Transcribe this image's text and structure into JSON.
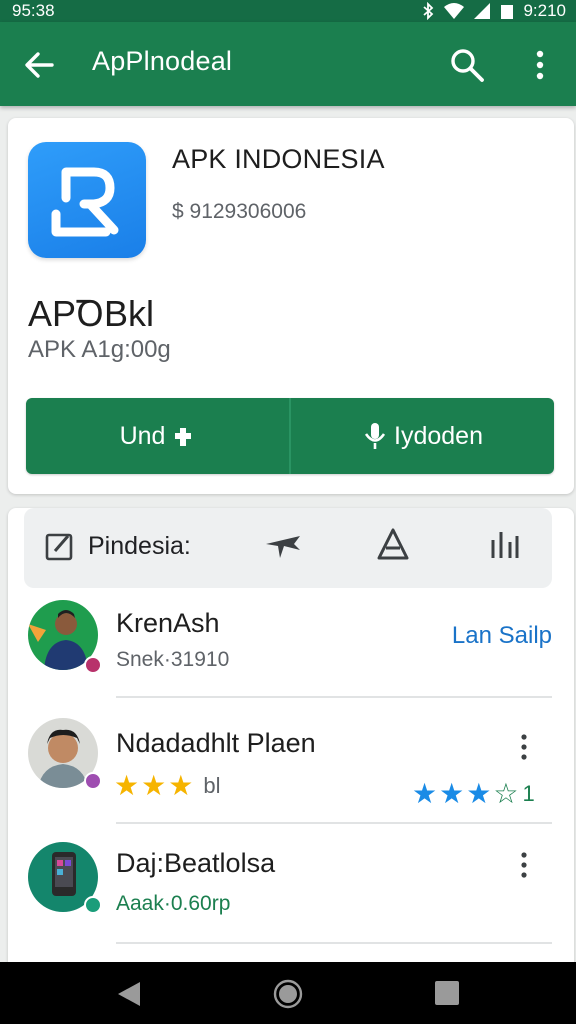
{
  "status_bar": {
    "time_left": "95:38",
    "time_right": "9:210"
  },
  "app_bar": {
    "title": "ApPlnodeal"
  },
  "app_card": {
    "name": "APK INDONESIA",
    "price": "$ 9129306006",
    "heading": "APꝹBkl",
    "subtitle": "APK A1g:00g",
    "button_left": "Und",
    "button_right": "Iydoden"
  },
  "filter": {
    "label": "Pindesia:"
  },
  "list": [
    {
      "title": "KrenAsh",
      "subtitle": "Snek·31910",
      "action": "Lan Sailp"
    },
    {
      "title": "Ndadadhlt Plaen",
      "rating_left": "bl",
      "rating_right": "1"
    },
    {
      "title": "Daj:Beatlolsa",
      "subtitle": "Aaak·0.60rp"
    }
  ],
  "colors": {
    "primary_green": "#1b7f4f",
    "status_green": "#156c45",
    "link_blue": "#1a73c8",
    "star_yellow": "#f6b400",
    "star_blue": "#1a8be6"
  }
}
